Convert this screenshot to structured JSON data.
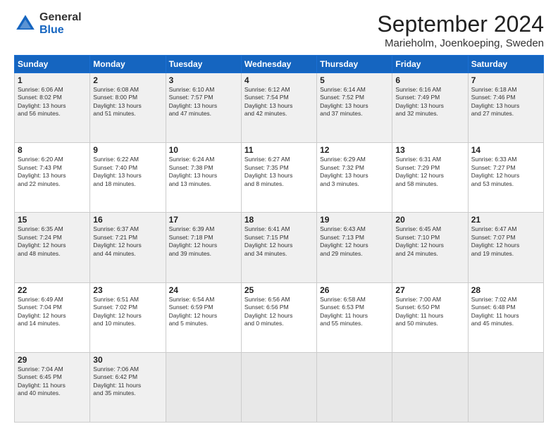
{
  "header": {
    "logo_line1": "General",
    "logo_line2": "Blue",
    "month_title": "September 2024",
    "subtitle": "Marieholm, Joenkoeping, Sweden"
  },
  "calendar": {
    "headers": [
      "Sunday",
      "Monday",
      "Tuesday",
      "Wednesday",
      "Thursday",
      "Friday",
      "Saturday"
    ],
    "weeks": [
      [
        {
          "day": "",
          "empty": true
        },
        {
          "day": "",
          "empty": true
        },
        {
          "day": "",
          "empty": true
        },
        {
          "day": "",
          "empty": true
        },
        {
          "day": "",
          "empty": true
        },
        {
          "day": "",
          "empty": true
        },
        {
          "day": "",
          "empty": true
        }
      ],
      [
        {
          "day": "1",
          "info": "Sunrise: 6:06 AM\nSunset: 8:02 PM\nDaylight: 13 hours\nand 56 minutes."
        },
        {
          "day": "2",
          "info": "Sunrise: 6:08 AM\nSunset: 8:00 PM\nDaylight: 13 hours\nand 51 minutes."
        },
        {
          "day": "3",
          "info": "Sunrise: 6:10 AM\nSunset: 7:57 PM\nDaylight: 13 hours\nand 47 minutes."
        },
        {
          "day": "4",
          "info": "Sunrise: 6:12 AM\nSunset: 7:54 PM\nDaylight: 13 hours\nand 42 minutes."
        },
        {
          "day": "5",
          "info": "Sunrise: 6:14 AM\nSunset: 7:52 PM\nDaylight: 13 hours\nand 37 minutes."
        },
        {
          "day": "6",
          "info": "Sunrise: 6:16 AM\nSunset: 7:49 PM\nDaylight: 13 hours\nand 32 minutes."
        },
        {
          "day": "7",
          "info": "Sunrise: 6:18 AM\nSunset: 7:46 PM\nDaylight: 13 hours\nand 27 minutes."
        }
      ],
      [
        {
          "day": "8",
          "info": "Sunrise: 6:20 AM\nSunset: 7:43 PM\nDaylight: 13 hours\nand 22 minutes."
        },
        {
          "day": "9",
          "info": "Sunrise: 6:22 AM\nSunset: 7:40 PM\nDaylight: 13 hours\nand 18 minutes."
        },
        {
          "day": "10",
          "info": "Sunrise: 6:24 AM\nSunset: 7:38 PM\nDaylight: 13 hours\nand 13 minutes."
        },
        {
          "day": "11",
          "info": "Sunrise: 6:27 AM\nSunset: 7:35 PM\nDaylight: 13 hours\nand 8 minutes."
        },
        {
          "day": "12",
          "info": "Sunrise: 6:29 AM\nSunset: 7:32 PM\nDaylight: 13 hours\nand 3 minutes."
        },
        {
          "day": "13",
          "info": "Sunrise: 6:31 AM\nSunset: 7:29 PM\nDaylight: 12 hours\nand 58 minutes."
        },
        {
          "day": "14",
          "info": "Sunrise: 6:33 AM\nSunset: 7:27 PM\nDaylight: 12 hours\nand 53 minutes."
        }
      ],
      [
        {
          "day": "15",
          "info": "Sunrise: 6:35 AM\nSunset: 7:24 PM\nDaylight: 12 hours\nand 48 minutes."
        },
        {
          "day": "16",
          "info": "Sunrise: 6:37 AM\nSunset: 7:21 PM\nDaylight: 12 hours\nand 44 minutes."
        },
        {
          "day": "17",
          "info": "Sunrise: 6:39 AM\nSunset: 7:18 PM\nDaylight: 12 hours\nand 39 minutes."
        },
        {
          "day": "18",
          "info": "Sunrise: 6:41 AM\nSunset: 7:15 PM\nDaylight: 12 hours\nand 34 minutes."
        },
        {
          "day": "19",
          "info": "Sunrise: 6:43 AM\nSunset: 7:13 PM\nDaylight: 12 hours\nand 29 minutes."
        },
        {
          "day": "20",
          "info": "Sunrise: 6:45 AM\nSunset: 7:10 PM\nDaylight: 12 hours\nand 24 minutes."
        },
        {
          "day": "21",
          "info": "Sunrise: 6:47 AM\nSunset: 7:07 PM\nDaylight: 12 hours\nand 19 minutes."
        }
      ],
      [
        {
          "day": "22",
          "info": "Sunrise: 6:49 AM\nSunset: 7:04 PM\nDaylight: 12 hours\nand 14 minutes."
        },
        {
          "day": "23",
          "info": "Sunrise: 6:51 AM\nSunset: 7:02 PM\nDaylight: 12 hours\nand 10 minutes."
        },
        {
          "day": "24",
          "info": "Sunrise: 6:54 AM\nSunset: 6:59 PM\nDaylight: 12 hours\nand 5 minutes."
        },
        {
          "day": "25",
          "info": "Sunrise: 6:56 AM\nSunset: 6:56 PM\nDaylight: 12 hours\nand 0 minutes."
        },
        {
          "day": "26",
          "info": "Sunrise: 6:58 AM\nSunset: 6:53 PM\nDaylight: 11 hours\nand 55 minutes."
        },
        {
          "day": "27",
          "info": "Sunrise: 7:00 AM\nSunset: 6:50 PM\nDaylight: 11 hours\nand 50 minutes."
        },
        {
          "day": "28",
          "info": "Sunrise: 7:02 AM\nSunset: 6:48 PM\nDaylight: 11 hours\nand 45 minutes."
        }
      ],
      [
        {
          "day": "29",
          "info": "Sunrise: 7:04 AM\nSunset: 6:45 PM\nDaylight: 11 hours\nand 40 minutes."
        },
        {
          "day": "30",
          "info": "Sunrise: 7:06 AM\nSunset: 6:42 PM\nDaylight: 11 hours\nand 35 minutes."
        },
        {
          "day": "",
          "empty": true
        },
        {
          "day": "",
          "empty": true
        },
        {
          "day": "",
          "empty": true
        },
        {
          "day": "",
          "empty": true
        },
        {
          "day": "",
          "empty": true
        }
      ]
    ]
  }
}
